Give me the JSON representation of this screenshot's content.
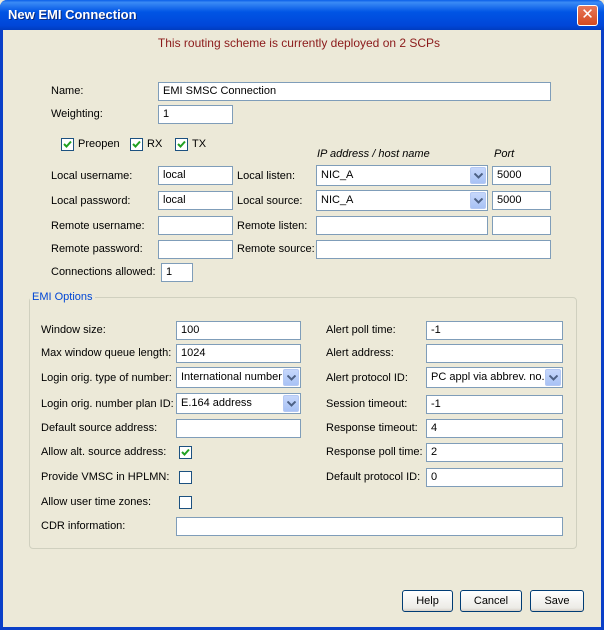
{
  "window": {
    "title": "New EMI Connection",
    "close_glyph": "✕"
  },
  "banner": "This routing scheme is currently deployed on 2 SCPs",
  "name": {
    "label": "Name:",
    "value": "EMI SMSC Connection"
  },
  "weighting": {
    "label": "Weighting:",
    "value": "1"
  },
  "flags": {
    "preopen": {
      "label": "Preopen",
      "checked": true
    },
    "rx": {
      "label": "RX",
      "checked": true
    },
    "tx": {
      "label": "TX",
      "checked": true
    }
  },
  "headers": {
    "ip": "IP address / host name",
    "port": "Port"
  },
  "local_username": {
    "label": "Local username:",
    "value": "local"
  },
  "local_password": {
    "label": "Local password:",
    "value": "local"
  },
  "remote_username": {
    "label": "Remote username:",
    "value": ""
  },
  "remote_password": {
    "label": "Remote password:",
    "value": ""
  },
  "connections_allowed": {
    "label": "Connections allowed:",
    "value": "1"
  },
  "local_listen": {
    "label": "Local listen:",
    "value": "NIC_A",
    "port": "5000"
  },
  "local_source": {
    "label": "Local source:",
    "value": "NIC_A",
    "port": "5000"
  },
  "remote_listen": {
    "label": "Remote listen:",
    "value": "",
    "port": ""
  },
  "remote_source": {
    "label": "Remote source:",
    "value": ""
  },
  "emi_options": {
    "title": "EMI Options",
    "window_size": {
      "label": "Window size:",
      "value": "100"
    },
    "max_window_queue": {
      "label": "Max window queue length:",
      "value": "1024"
    },
    "login_ton": {
      "label": "Login orig. type of number:",
      "value": "International number"
    },
    "login_npi": {
      "label": "Login orig. number plan ID:",
      "value": "E.164 address"
    },
    "default_source": {
      "label": "Default source address:",
      "value": ""
    },
    "allow_alt_source": {
      "label": "Allow alt. source address:",
      "checked": true
    },
    "provide_vmsc": {
      "label": "Provide VMSC in HPLMN:",
      "checked": false
    },
    "allow_user_tz": {
      "label": "Allow user time zones:",
      "checked": false
    },
    "cdr_info": {
      "label": "CDR information:",
      "value": ""
    },
    "alert_poll_time": {
      "label": "Alert poll time:",
      "value": "-1"
    },
    "alert_address": {
      "label": "Alert address:",
      "value": ""
    },
    "alert_protocol": {
      "label": "Alert protocol ID:",
      "value": "PC appl via abbrev. no."
    },
    "session_timeout": {
      "label": "Session timeout:",
      "value": "-1"
    },
    "response_timeout": {
      "label": "Response timeout:",
      "value": "4"
    },
    "response_poll_time": {
      "label": "Response poll time:",
      "value": "2"
    },
    "default_protocol": {
      "label": "Default protocol ID:",
      "value": "0"
    }
  },
  "buttons": {
    "help": "Help",
    "cancel": "Cancel",
    "save": "Save"
  }
}
